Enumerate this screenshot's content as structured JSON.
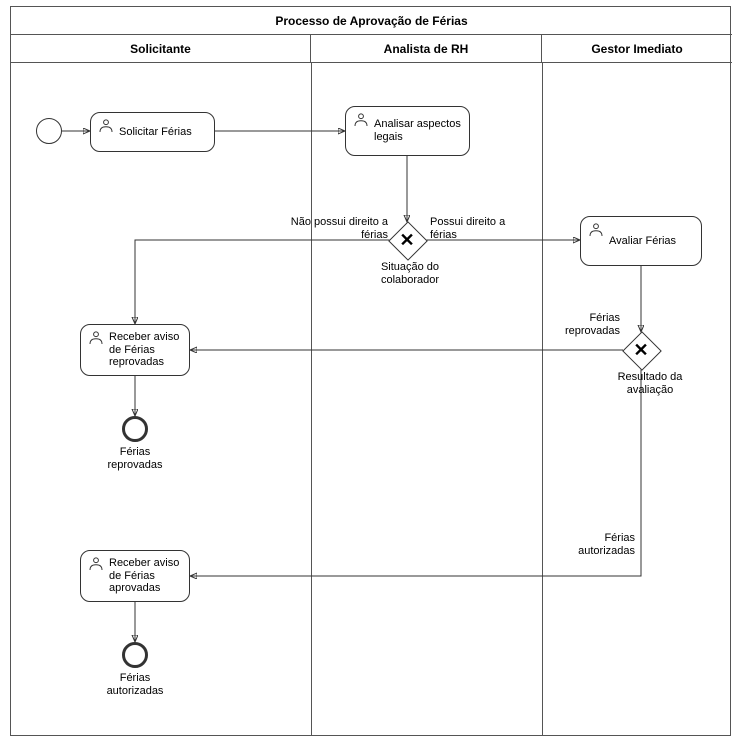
{
  "pool": {
    "title": "Processo de Aprovação de Férias"
  },
  "lanes": {
    "solicitante": "Solicitante",
    "analista": "Analista de RH",
    "gestor": "Gestor Imediato"
  },
  "tasks": {
    "solicitar": "Solicitar Férias",
    "analisar": "Analisar aspectos legais",
    "avaliar": "Avaliar Férias",
    "receber_reprov": "Receber aviso de Férias reprovadas",
    "receber_aprov": "Receber aviso de Férias aprovadas"
  },
  "gateways": {
    "situacao": "Situação do colaborador",
    "resultado": "Resultado da avaliação"
  },
  "edges": {
    "nao_possui": "Não possui direito a férias",
    "possui": "Possui direito a férias",
    "ferias_reprov": "Férias reprovadas",
    "ferias_autoriz": "Férias autorizadas"
  },
  "end_events": {
    "reprov": "Férias reprovadas",
    "autoriz": "Férias autorizadas"
  }
}
